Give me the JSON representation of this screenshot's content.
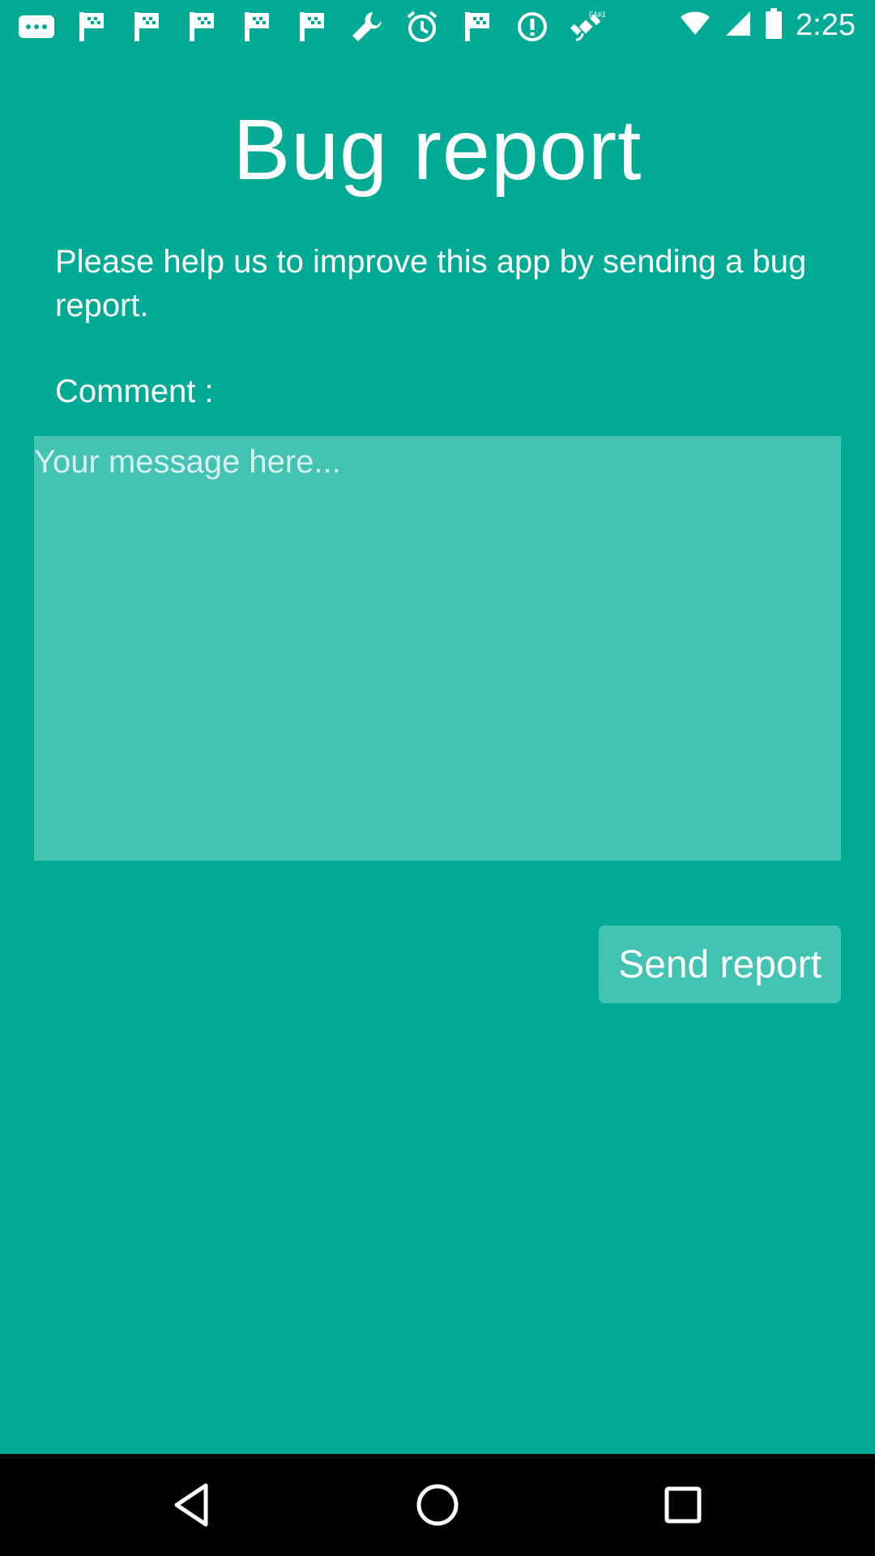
{
  "status_bar": {
    "time": "2:25",
    "icons": [
      "more-icon",
      "flag-icon",
      "flag-icon",
      "flag-icon",
      "flag-icon",
      "flag-icon",
      "wrench-icon",
      "alarm-icon",
      "flag-icon",
      "info-icon",
      "satellite-icon",
      "wifi-icon",
      "signal-icon",
      "battery-icon"
    ]
  },
  "page": {
    "title": "Bug report",
    "intro": "Please help us to improve this app by sending a bug report.",
    "comment_label": "Comment :",
    "message_placeholder": "Your message here...",
    "message_value": "",
    "send_label": "Send report"
  },
  "colors": {
    "background": "#00ab96",
    "field": "#43c3b2",
    "nav_bar": "#000000",
    "text": "#ffffff"
  },
  "nav_bar": {
    "buttons": [
      "back-icon",
      "home-icon",
      "recent-apps-icon"
    ]
  }
}
